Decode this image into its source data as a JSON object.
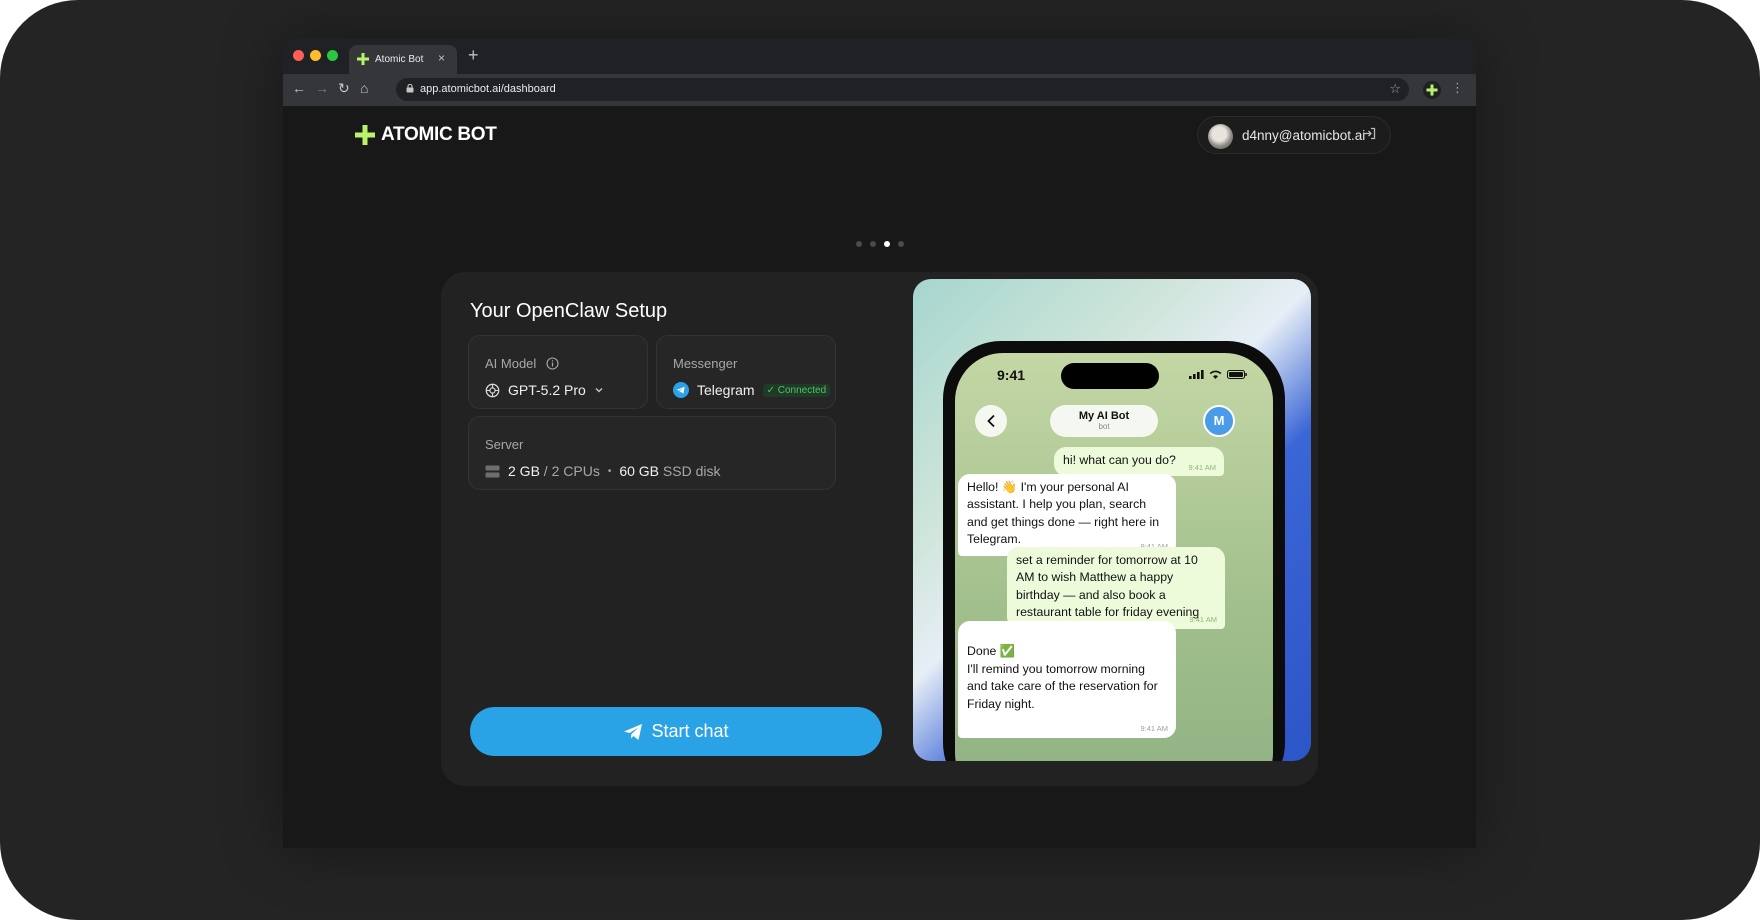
{
  "browser": {
    "tab_title": "Atomic Bot",
    "tab_close": "×",
    "new_tab": "+",
    "url": "app.atomicbot.ai/dashboard"
  },
  "header": {
    "brand": "ATOMIC BOT",
    "brand_color": "#b8f26b",
    "account_email": "d4nny@atomicbot.ai"
  },
  "carousel": {
    "total": 4,
    "active_index": 2
  },
  "setup": {
    "title": "Your OpenClaw Setup",
    "ai_model": {
      "label": "AI Model",
      "value": "GPT-5.2 Pro"
    },
    "messenger": {
      "label": "Messenger",
      "value": "Telegram",
      "status": "Connected"
    },
    "server": {
      "label": "Server",
      "ram": "2 GB",
      "cpus": "2 CPUs",
      "disk_size": "60 GB",
      "disk_type": "SSD disk"
    },
    "start_button": "Start chat",
    "accent_color": "#2aa3e6"
  },
  "phone": {
    "time": "9:41",
    "bot_name": "My AI Bot",
    "bot_subtitle": "bot",
    "avatar_letter": "M",
    "messages": [
      {
        "from": "user",
        "text": "hi! what can you do?",
        "time": "9:41 AM"
      },
      {
        "from": "bot",
        "text": "Hello! 👋 I'm your personal AI assistant. I help you plan, search and get things done — right here in Telegram.",
        "time": "9:41 AM"
      },
      {
        "from": "user",
        "text": "set a reminder for tomorrow at 10 AM to wish Matthew a happy birthday — and also book a restaurant table for friday evening",
        "time": "9:41 AM"
      },
      {
        "from": "bot",
        "text": "Done ✅\nI'll remind you tomorrow morning and take care of the reservation for Friday night.",
        "time": "9:41 AM"
      }
    ]
  }
}
